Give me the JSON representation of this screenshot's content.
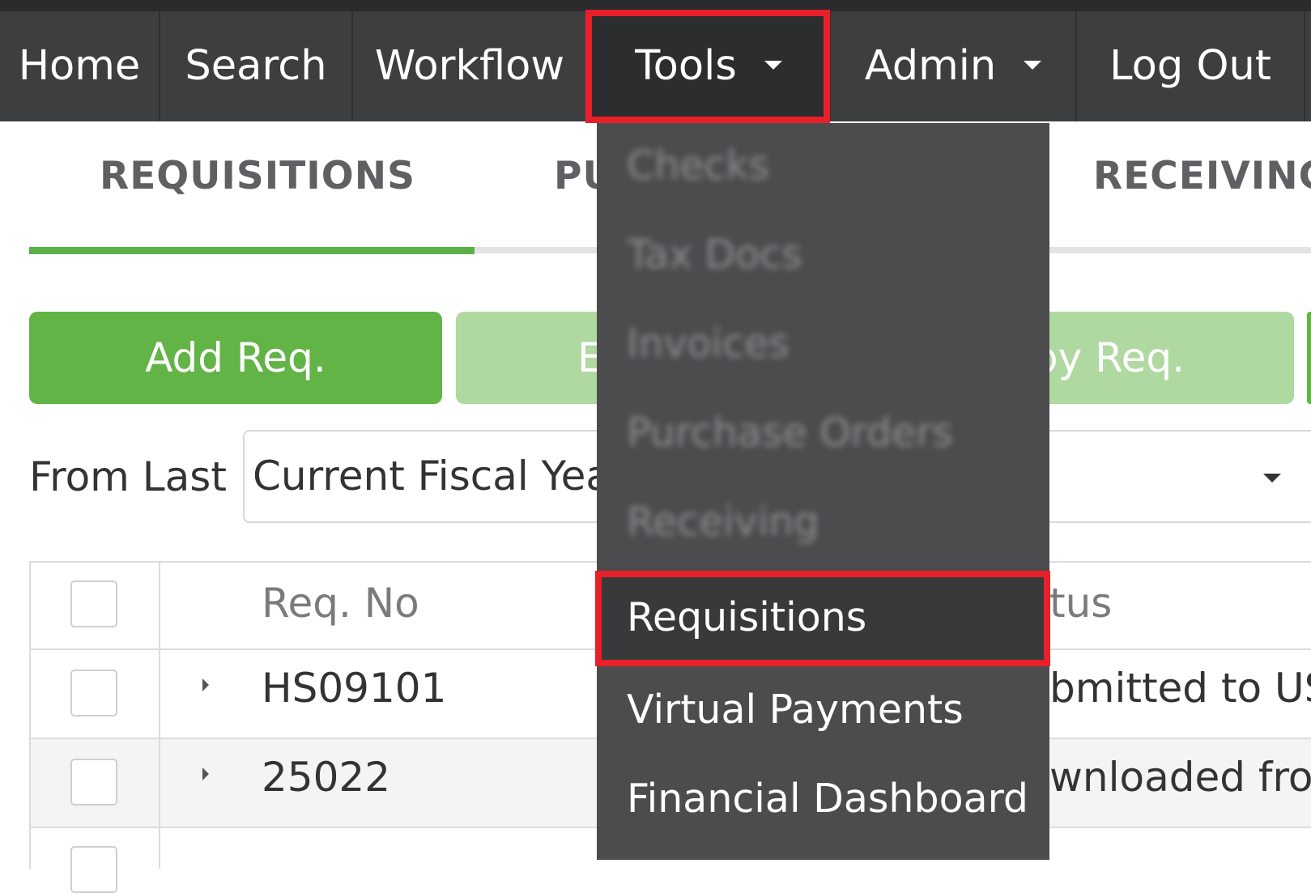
{
  "nav": {
    "home": "Home",
    "search": "Search",
    "workflow": "Workflow",
    "tools": "Tools",
    "admin": "Admin",
    "logout": "Log Out"
  },
  "tabs": {
    "requisitions": "REQUISITIONS",
    "purchase_partial": "PU",
    "receiving": "RECEIVING"
  },
  "buttons": {
    "add_req": "Add Req.",
    "edit_partial": "E",
    "copy_partial": "py Req."
  },
  "filter": {
    "label": "From Last",
    "value": "Current Fiscal Yea"
  },
  "table": {
    "headers": {
      "req_no": "Req. No",
      "status_partial": "tus"
    },
    "rows": [
      {
        "req_no": "HS09101",
        "status_partial": "bmitted to US"
      },
      {
        "req_no": "25022",
        "status_partial": "wnloaded fro"
      }
    ]
  },
  "tools_menu": {
    "items_blurred": [
      "Checks",
      "Tax Docs",
      "Invoices",
      "Purchase Orders",
      "Receiving"
    ],
    "requisitions": "Requisitions",
    "virtual_payments": "Virtual Payments",
    "financial_dashboard": "Financial Dashboard"
  },
  "colors": {
    "navbar": "#3d3e40",
    "accent_green": "#62b446",
    "highlight_red": "#e8202a",
    "menu_bg": "#4c4c4f"
  }
}
